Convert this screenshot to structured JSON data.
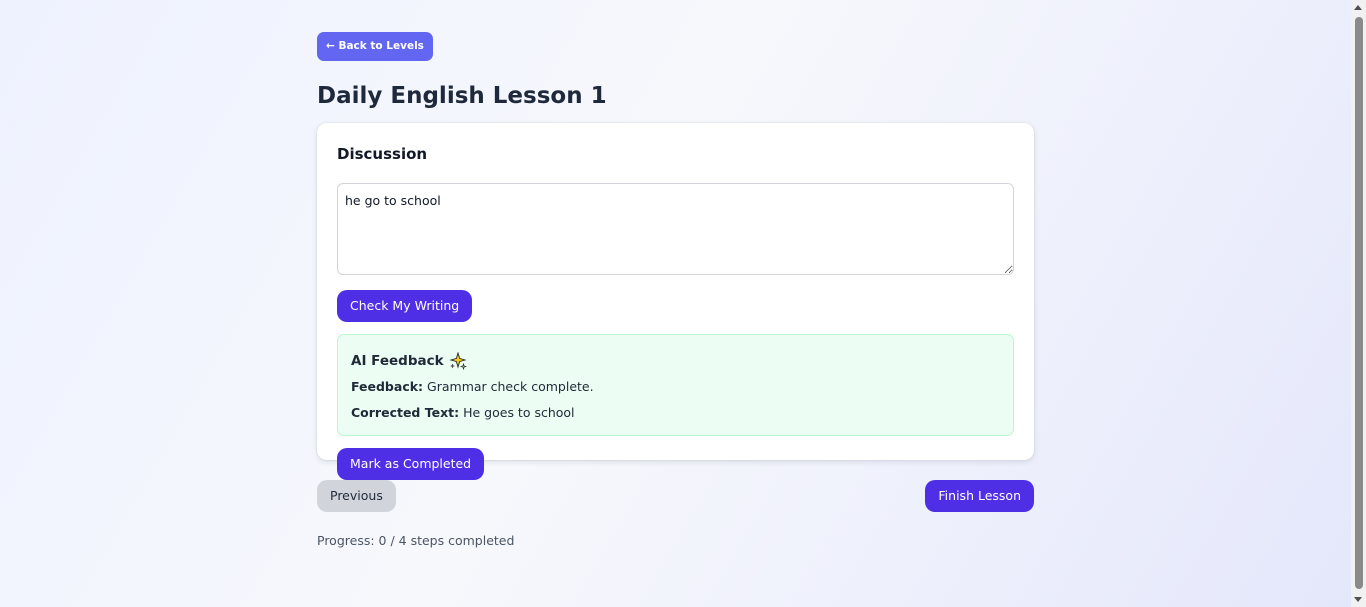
{
  "nav": {
    "back_label": "← Back to Levels"
  },
  "page": {
    "title": "Daily English Lesson 1"
  },
  "card": {
    "title": "Discussion",
    "textarea_value": "he go to school",
    "check_button": "Check My Writing",
    "feedback": {
      "title": "AI Feedback",
      "icon": "sparkle-icon",
      "feedback_label": "Feedback:",
      "feedback_text": "Grammar check complete.",
      "corrected_label": "Corrected Text:",
      "corrected_text": "He goes to school"
    },
    "mark_button": "Mark as Completed"
  },
  "footer": {
    "previous_label": "Previous",
    "finish_label": "Finish Lesson",
    "progress_text": "Progress: 0 / 4 steps completed"
  },
  "colors": {
    "primary": "#4f2fe6",
    "back_button": "#6366f1",
    "feedback_bg": "#ecfdf3",
    "feedback_border": "#bbf7d0",
    "secondary_button": "#d1d5db"
  }
}
